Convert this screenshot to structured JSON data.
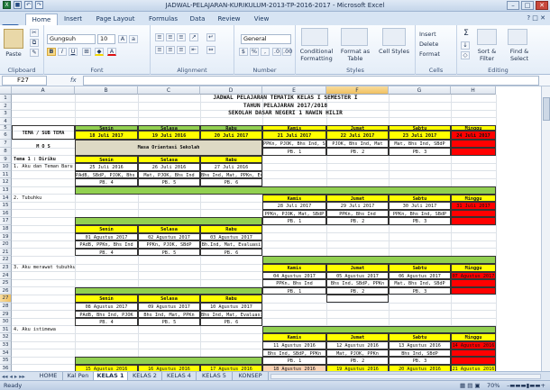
{
  "window": {
    "title": "JADWAL-PELAJARAN-KURIKULUM-2013-TP-2016-2017 - Microsoft Excel",
    "controls": [
      "–",
      "□",
      "✕"
    ]
  },
  "qat_icons": [
    "excel-icon",
    "save-icon",
    "undo-icon",
    "redo-icon"
  ],
  "tabs": [
    "Home",
    "Insert",
    "Page Layout",
    "Formulas",
    "Data",
    "Review",
    "View"
  ],
  "ribbon": {
    "clipboard": {
      "label": "Clipboard",
      "paste": "Paste"
    },
    "font": {
      "label": "Font",
      "name": "Gungsuh",
      "size": "10",
      "bold": "B",
      "italic": "I",
      "underline": "U"
    },
    "alignment": {
      "label": "Alignment"
    },
    "number": {
      "label": "Number",
      "format": "General",
      "currency": "$",
      "percent": "%",
      "comma": ","
    },
    "styles": {
      "label": "Styles",
      "conditional": "Conditional Formatting",
      "format_table": "Format as Table",
      "cell_styles": "Cell Styles"
    },
    "cells": {
      "label": "Cells",
      "insert": "Insert",
      "delete": "Delete",
      "format": "Format"
    },
    "editing": {
      "label": "Editing",
      "sum": "Σ",
      "sort": "Sort & Filter",
      "find": "Find & Select"
    }
  },
  "formula_bar": {
    "name_box": "F27",
    "fx": "fx",
    "value": ""
  },
  "columns": [
    "A",
    "B",
    "C",
    "D",
    "E",
    "F",
    "G",
    "H"
  ],
  "rows": [
    "1",
    "2",
    "3",
    "4",
    "5",
    "6",
    "7",
    "8",
    "9",
    "10",
    "11",
    "12",
    "13",
    "14",
    "15",
    "16",
    "17",
    "18",
    "19",
    "20",
    "21",
    "22",
    "23",
    "24",
    "25",
    "26",
    "27",
    "28",
    "29",
    "30",
    "31",
    "32",
    "33",
    "34",
    "35",
    "36"
  ],
  "sheet": {
    "title1": "JADWAL PELAJARAN TEMATIK KELAS  I  SEMESTER  I",
    "title2": "TAHUN PELAJARAN 2017/2018",
    "title3": "SEKOLAH DASAR NEGERI 1 NAWIN HILIR",
    "tema_sub": "TEMA / SUB TEMA",
    "days": {
      "senin": "Senin",
      "selasa": "Selasa",
      "rabu": "Rabu",
      "kamis": "Kamis",
      "jumat": "Jumat",
      "sabtu": "Sabtu",
      "minggu": "Minggu"
    },
    "r6": [
      "18 Juli 2017",
      "19 Juli 2016",
      "20 Juli 2017",
      "21 Juli 2017",
      "22 Juli 2017",
      "23 Juli 2017",
      "24 Juli 2017"
    ],
    "mos": "M O S",
    "masa": "Masa Orientasi Sekolah",
    "r7": [
      "PPKn, PJOK, Bhs Ind, SBdP",
      "PJOK, Bhs Ind, Mat",
      "Mat, Bhs Ind, SBdP"
    ],
    "r8": [
      "PB. 1",
      "PB. 2",
      "PB. 3"
    ],
    "tema1": "Tema 1 : Diriku",
    "sub1": "1. Aku dan Teman Baru",
    "r10": [
      "25 Juli 2016",
      "26 Juli 2016",
      "27 Juli 2016"
    ],
    "r11": [
      "PAdB, SBdP, PJOK, Bhs Ind",
      "Mat, PJOK, Bhs Ind",
      "Bhs Ind, Mat, PPKn, Evaluasi"
    ],
    "r12": [
      "PB. 4",
      "PB. 5",
      "PB. 6"
    ],
    "sub2": "2. Tubuhku",
    "r14": [
      "28 Juli 2017",
      "29 Juli 2017",
      "30 Juli 2017",
      "31 Juli 2017"
    ],
    "r15": [
      "PPKn, PJOK, Mat, SBdP",
      "PPKn, Bhs Ind",
      "PPKn, Bhs Ind, SBdP"
    ],
    "r16": [
      "PB. 1",
      "PB. 2",
      "PB. 3"
    ],
    "r18": [
      "01 Agustus 2017",
      "02 Agustus 2017",
      "03 Agustus 2017"
    ],
    "r19": [
      "PAdB, PPKn, Bhs Ind",
      "PPKn, PJOK, SBdP",
      "Bh.Ind, Mat, Evaluasi"
    ],
    "r20": [
      "PB. 4",
      "PB. 5",
      "PB. 6"
    ],
    "sub3": "3. Aku merawat tubuhku",
    "r22": [
      "04 Agustus 2017",
      "05 Agustus 2017",
      "06 Agustus 2017",
      "07 Agustus 2017"
    ],
    "r23": [
      "PPKn, Bhs Ind",
      "Bhs Ind, SBdP, PPKn",
      "Mat, Bhs Ind, SBdP"
    ],
    "r24": [
      "PB. 1",
      "PB. 2",
      "PB. 3"
    ],
    "r26": [
      "08 Agustus 2017",
      "09 Agustus 2017",
      "10 Agustus 2017"
    ],
    "r27": [
      "PAdB, Bhs Ind, PJOK",
      "Bhs Ind, Mat, PPKn",
      "Bhs Ind, Mat, Evaluasi"
    ],
    "r28": [
      "PB. 4",
      "PB. 5",
      "PB. 6"
    ],
    "sub4": "4. Aku istimewa",
    "r30": [
      "11 Agustus 2016",
      "12 Agustus 2016",
      "13 Agustus 2016",
      "14 Agustus 2016"
    ],
    "r31": [
      "Bhs Ind, SBdP, PPKn",
      "Mat, PJOK, PPKn",
      "Bhs Ind, SBdP"
    ],
    "r32": [
      "PB. 1",
      "PB. 2",
      "PB. 3"
    ],
    "r34": [
      "15 Agustus 2016",
      "16 Agustus 2016",
      "17 Agustus 2016",
      "18 Agustus 2016",
      "19 Agustus 2016",
      "20 Agustus 2016",
      "21 Agustus 2016"
    ]
  },
  "sheet_tabs": [
    "HOME",
    "Kal Pen",
    "KELAS 1",
    "KELAS 2",
    "KELAS 4",
    "KELAS 5",
    "KONSEP"
  ],
  "status": {
    "mode": "Ready",
    "zoom": "70%"
  }
}
